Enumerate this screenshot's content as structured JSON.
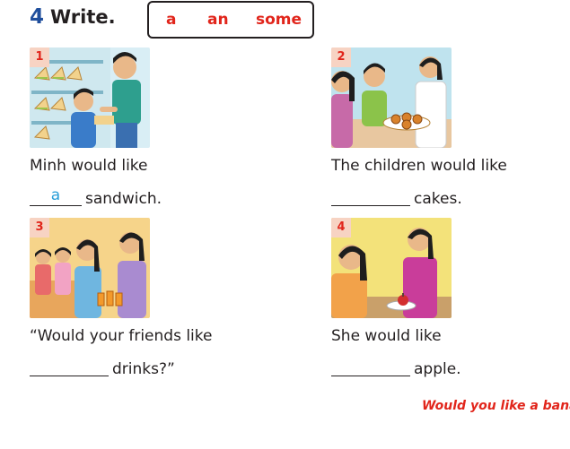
{
  "exercise": {
    "number": "4",
    "title": "Write."
  },
  "word_box": [
    "a",
    "an",
    "some"
  ],
  "items": [
    {
      "number": "1",
      "sentence": "Minh would like",
      "answer": "a",
      "continuation": "sandwich."
    },
    {
      "number": "2",
      "sentence": "The children would like",
      "answer": "",
      "continuation": "cakes."
    },
    {
      "number": "3",
      "sentence": "“Would your friends like",
      "answer": "",
      "continuation": "drinks?”"
    },
    {
      "number": "4",
      "sentence": "She would like",
      "answer": "",
      "continuation": "apple."
    }
  ],
  "footer": "Would you like a bana",
  "colors": {
    "number_blue": "#1f4e9c",
    "word_red": "#e1251b",
    "answer_blue": "#2a9fd8",
    "badge_bg": "#f7d3c3"
  }
}
